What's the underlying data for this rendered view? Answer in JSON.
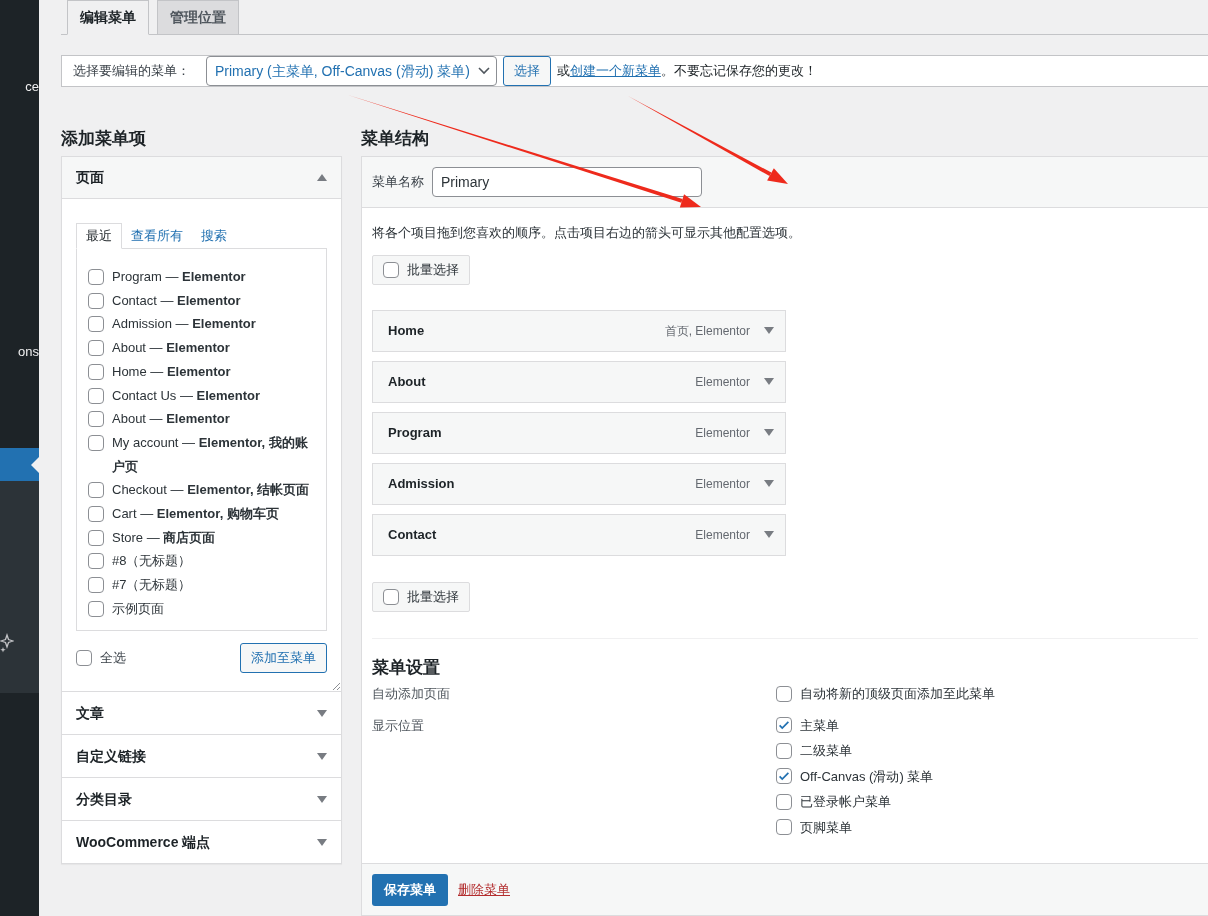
{
  "sidebar": {
    "items": [
      {
        "label": "ce",
        "selected": false
      },
      {
        "label": "ons",
        "selected": false
      },
      {
        "selected": true
      }
    ]
  },
  "tabs": [
    {
      "label": "编辑菜单",
      "selected": true
    },
    {
      "label": "管理位置",
      "selected": false
    }
  ],
  "menu_selector": {
    "label": "选择要编辑的菜单：",
    "value": "Primary (主菜单, Off-Canvas (滑动) 菜单)",
    "button": "选择",
    "note_before": "或",
    "link": "创建一个新菜单",
    "note_after": "。不要忘记保存您的更改！"
  },
  "add_items": {
    "title": "添加菜单项",
    "panels": [
      {
        "title": "页面",
        "expanded": true,
        "tabs": [
          {
            "label": "最近",
            "selected": true
          },
          {
            "label": "查看所有",
            "selected": false
          },
          {
            "label": "搜索",
            "selected": false
          }
        ],
        "items": [
          {
            "label": "Program — **Elementor**",
            "checked": false
          },
          {
            "label": "Contact — **Elementor**",
            "checked": false
          },
          {
            "label": "Admission — **Elementor**",
            "checked": false
          },
          {
            "label": "About — **Elementor**",
            "checked": false
          },
          {
            "label": "Home — **Elementor**",
            "checked": false
          },
          {
            "label": "Contact Us — **Elementor**",
            "checked": false
          },
          {
            "label": "About — **Elementor**",
            "checked": false
          },
          {
            "label": "My account — **Elementor, 我的账户页**",
            "checked": false
          },
          {
            "label": "Checkout — **Elementor, 结帐页面**",
            "checked": false
          },
          {
            "label": "Cart — **Elementor, 购物车页**",
            "checked": false
          },
          {
            "label": "Store — **商店页面**",
            "checked": false
          },
          {
            "label": "#8（无标题）",
            "checked": false
          },
          {
            "label": "#7（无标题）",
            "checked": false
          },
          {
            "label": "示例页面",
            "checked": false
          }
        ],
        "select_all": {
          "label": "全选",
          "checked": false
        },
        "button": "添加至菜单"
      },
      {
        "title": "文章",
        "expanded": false
      },
      {
        "title": "自定义链接",
        "expanded": false
      },
      {
        "title": "分类目录",
        "expanded": false
      },
      {
        "title": "WooCommerce 端点",
        "expanded": false
      }
    ]
  },
  "structure": {
    "title": "菜单结构",
    "name_label": "菜单名称",
    "name_value": "Primary",
    "instructions": "将各个项目拖到您喜欢的顺序。点击项目右边的箭头可显示其他配置选项。",
    "bulk_select_top": {
      "label": "批量选择",
      "checked": false
    },
    "items": [
      {
        "title": "Home",
        "type": "首页, Elementor"
      },
      {
        "title": "About",
        "type": "Elementor"
      },
      {
        "title": "Program",
        "type": "Elementor"
      },
      {
        "title": "Admission",
        "type": "Elementor"
      },
      {
        "title": "Contact",
        "type": "Elementor"
      }
    ],
    "bulk_select_bottom": {
      "label": "批量选择",
      "checked": false
    },
    "settings": {
      "title": "菜单设置",
      "rows": [
        {
          "label": "自动添加页面",
          "options": [
            {
              "label": "自动将新的顶级页面添加至此菜单",
              "checked": false
            }
          ]
        },
        {
          "label": "显示位置",
          "options": [
            {
              "label": "主菜单",
              "checked": true
            },
            {
              "label": "二级菜单",
              "checked": false
            },
            {
              "label": "Off-Canvas (滑动) 菜单",
              "checked": true
            },
            {
              "label": "已登录帐户菜单",
              "checked": false
            },
            {
              "label": "页脚菜单",
              "checked": false
            }
          ]
        }
      ]
    },
    "save": "保存菜单",
    "delete": "删除菜单"
  }
}
